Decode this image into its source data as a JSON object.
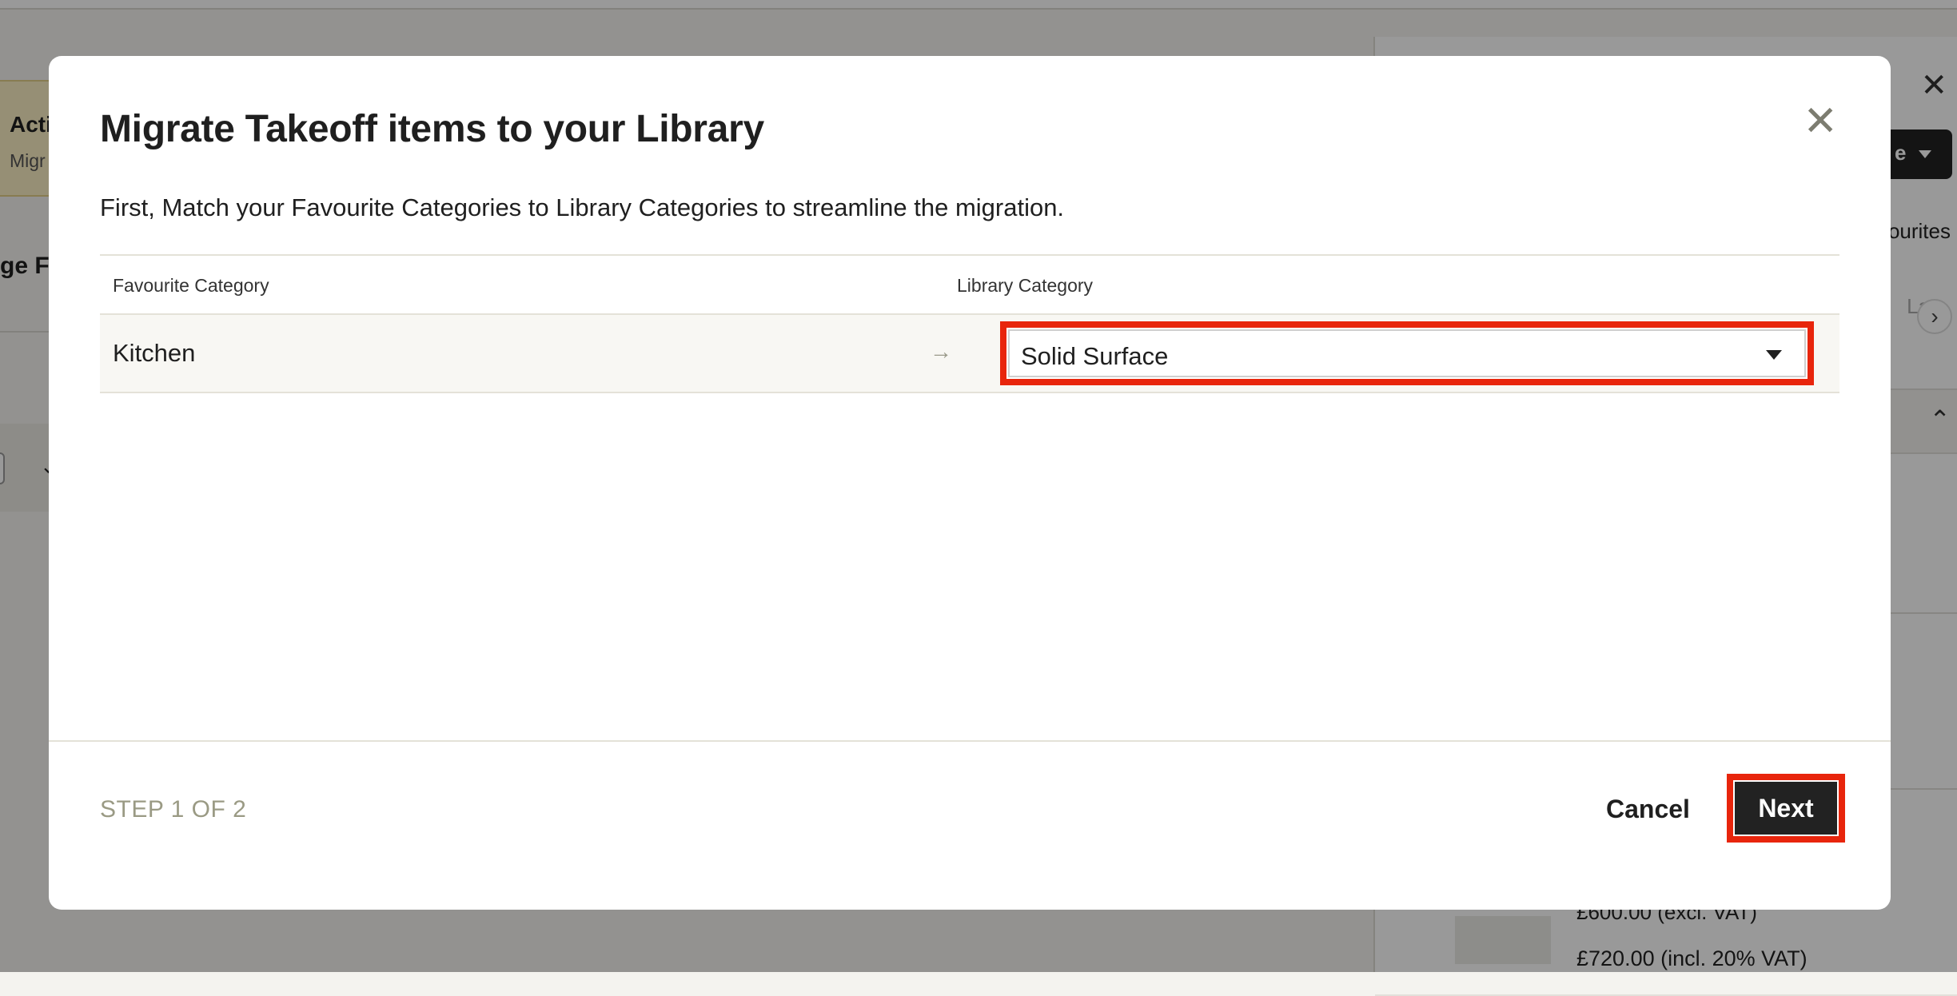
{
  "background": {
    "notice": {
      "title": "Acti",
      "subtitle": "Migr"
    },
    "left_heading": "ge Fa",
    "right_panel": {
      "close_glyph": "✕",
      "dark_button_label": "e",
      "favourites_label": "ourites",
      "lab_label": "La",
      "next_glyph": "›",
      "collapse_glyph": "⌃",
      "price_excl": "£600.00 (excl. VAT)",
      "price_incl": "£720.00 (incl. 20% VAT)"
    }
  },
  "modal": {
    "title": "Migrate Takeoff items to your Library",
    "description": "First, Match your Favourite Categories to Library Categories to streamline the migration.",
    "close_glyph": "✕",
    "table": {
      "headers": {
        "favourite": "Favourite Category",
        "library": "Library Category"
      },
      "rows": [
        {
          "favourite": "Kitchen",
          "arrow": "→",
          "library_selected": "Solid Surface"
        }
      ]
    },
    "footer": {
      "step": "STEP 1 OF 2",
      "cancel_label": "Cancel",
      "next_label": "Next"
    }
  },
  "colors": {
    "highlight": "#e8250c",
    "primary_button": "#222222",
    "muted_text": "#9a9a84"
  }
}
